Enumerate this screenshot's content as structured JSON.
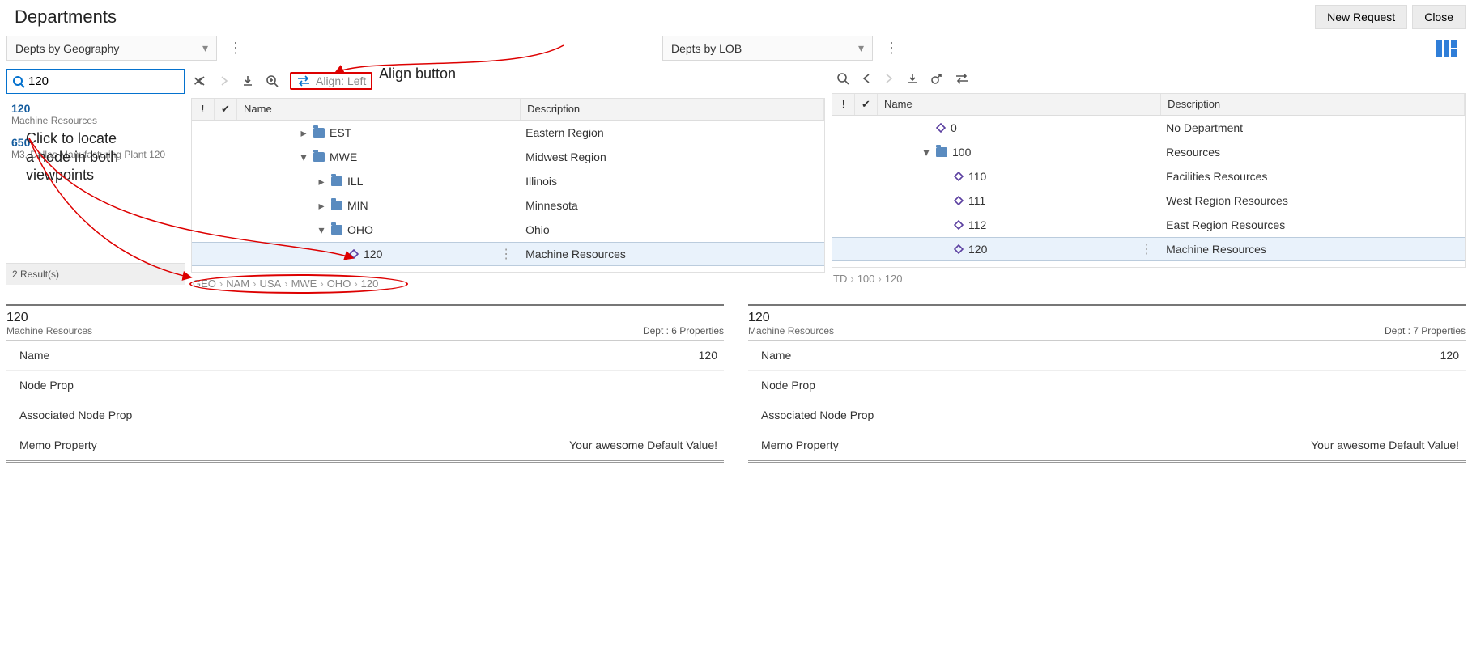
{
  "page": {
    "title": "Departments",
    "new_request": "New Request",
    "close": "Close"
  },
  "selectors": {
    "left": {
      "label": "Depts by Geography"
    },
    "right": {
      "label": "Depts by LOB"
    }
  },
  "search": {
    "value": "120",
    "results": [
      {
        "code": "120",
        "sub": "Machine Resources"
      },
      {
        "code": "650",
        "sub": "M3, Dallas Manufacturing Plant 120"
      }
    ],
    "footer": "2 Result(s)"
  },
  "annotations": {
    "align_button": "Align button",
    "locate": "Click to locate\na node in both\nviewpoints"
  },
  "left_vp": {
    "align_label": "Align: Left",
    "cols": {
      "name": "Name",
      "description": "Description"
    },
    "rows": [
      {
        "indent": 3,
        "caret": "right",
        "type": "folder",
        "name": "EST",
        "desc": "Eastern Region"
      },
      {
        "indent": 3,
        "caret": "down",
        "type": "folder",
        "name": "MWE",
        "desc": "Midwest Region"
      },
      {
        "indent": 4,
        "caret": "right",
        "type": "folder",
        "name": "ILL",
        "desc": "Illinois"
      },
      {
        "indent": 4,
        "caret": "right",
        "type": "folder",
        "name": "MIN",
        "desc": "Minnesota"
      },
      {
        "indent": 4,
        "caret": "down",
        "type": "folder",
        "name": "OHO",
        "desc": "Ohio"
      },
      {
        "indent": 5,
        "caret": "",
        "type": "node",
        "name": "120",
        "desc": "Machine Resources",
        "selected": true
      }
    ],
    "path": [
      "GEO",
      "NAM",
      "USA",
      "MWE",
      "OHO",
      "120"
    ]
  },
  "right_vp": {
    "cols": {
      "name": "Name",
      "description": "Description"
    },
    "rows": [
      {
        "indent": 2,
        "caret": "",
        "type": "node",
        "name": "0",
        "desc": "No Department"
      },
      {
        "indent": 2,
        "caret": "down",
        "type": "folder",
        "name": "100",
        "desc": "Resources"
      },
      {
        "indent": 3,
        "caret": "",
        "type": "node",
        "name": "110",
        "desc": "Facilities Resources"
      },
      {
        "indent": 3,
        "caret": "",
        "type": "node",
        "name": "111",
        "desc": "West Region Resources"
      },
      {
        "indent": 3,
        "caret": "",
        "type": "node",
        "name": "112",
        "desc": "East Region Resources"
      },
      {
        "indent": 3,
        "caret": "",
        "type": "node",
        "name": "120",
        "desc": "Machine Resources",
        "selected": true
      }
    ],
    "path": [
      "TD",
      "100",
      "120"
    ]
  },
  "props_left": {
    "title": "120",
    "subtitle": "Machine Resources",
    "meta": "Dept : 6 Properties",
    "rows": [
      {
        "k": "Name",
        "v": "120"
      },
      {
        "k": "Node Prop",
        "v": ""
      },
      {
        "k": "Associated Node Prop",
        "v": ""
      },
      {
        "k": "Memo Property",
        "v": "Your awesome Default Value!"
      }
    ]
  },
  "props_right": {
    "title": "120",
    "subtitle": "Machine Resources",
    "meta": "Dept : 7 Properties",
    "rows": [
      {
        "k": "Name",
        "v": "120"
      },
      {
        "k": "Node Prop",
        "v": ""
      },
      {
        "k": "Associated Node Prop",
        "v": ""
      },
      {
        "k": "Memo Property",
        "v": "Your awesome Default Value!"
      }
    ]
  }
}
